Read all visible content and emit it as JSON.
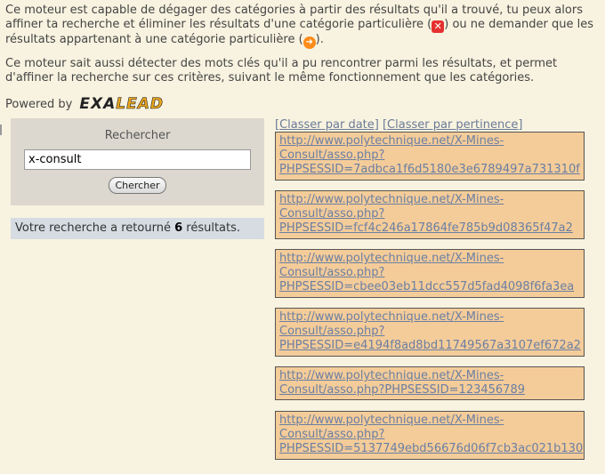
{
  "intro": {
    "p1_a": "Ce moteur est capable de dégager des catégories à partir des résultats qu'il a trouvé, tu peux alors affiner ta recherche et éliminer les résultats d'une catégorie particulière (",
    "p1_b": ") ou ne demander que les résultats appartenant à une catégorie particulière (",
    "p1_c": ").",
    "p2": "Ce moteur sait aussi détecter des mots clés qu'il a pu rencontrer parmi les résultats, et permet d'affiner la recherche sur ces critères, suivant le même fonctionnement que les catégories.",
    "exclude_icon": "✕",
    "include_icon": "➜"
  },
  "powered": {
    "label": "Powered by",
    "logo_a": "EXA",
    "logo_b": "LEAD"
  },
  "search": {
    "title": "Rechercher",
    "value": "x-consult",
    "button": "Chercher"
  },
  "results_count": {
    "prefix": "Votre recherche a retourné ",
    "count": "6",
    "suffix": " résultats."
  },
  "sort": {
    "by_date": "[Classer par date]",
    "by_relevance": "[Classer par pertinence]"
  },
  "results": [
    "http://www.polytechnique.net/X-Mines-\nConsult/asso.php?\nPHPSESSID=7adbca1f6d5180e3e6789497a731310f",
    "http://www.polytechnique.net/X-Mines-\nConsult/asso.php?\nPHPSESSID=fcf4c246a17864fe785b9d08365f47a2",
    "http://www.polytechnique.net/X-Mines-\nConsult/asso.php?\nPHPSESSID=cbee03eb11dcc557d5fad4098f6fa3ea",
    "http://www.polytechnique.net/X-Mines-\nConsult/asso.php?\nPHPSESSID=e4194f8ad8bd11749567a3107ef672a2",
    "http://www.polytechnique.net/X-Mines-\nConsult/asso.php?PHPSESSID=123456789",
    "http://www.polytechnique.net/X-Mines-\nConsult/asso.php?\nPHPSESSID=5137749ebd56676d06f7cb3ac021b130"
  ]
}
